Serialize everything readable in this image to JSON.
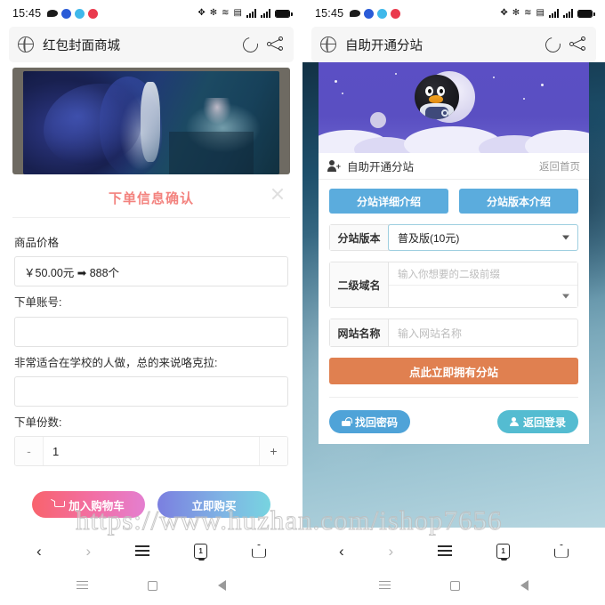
{
  "status_bar": {
    "time": "15:45",
    "app_icons": [
      "message-icon",
      "qq-icon",
      "wechat-icon",
      "weibo-icon"
    ],
    "right_icons": [
      "nfc-icon",
      "bluetooth-icon",
      "wifi-icon",
      "vpn-icon",
      "signal-1-icon",
      "signal-2-icon",
      "battery-icon"
    ]
  },
  "left_phone": {
    "browser": {
      "title": "红包封面商城",
      "reload_label": "刷新",
      "share_label": "分享"
    },
    "hero_alt": "红包封面预览图",
    "dialog": {
      "title": "下单信息确认",
      "close_label": "×",
      "fields": [
        {
          "label": "商品价格",
          "value": "￥50.00元 ➡ 888个",
          "placeholder": "",
          "readonly": true
        },
        {
          "label": "下单账号:",
          "value": "",
          "placeholder": "",
          "readonly": false
        },
        {
          "label": "非常适合在学校的人做，总的来说咯克拉:",
          "value": "",
          "placeholder": "",
          "readonly": false
        }
      ],
      "quantity": {
        "label": "下单份数:",
        "minus": "-",
        "value": "1",
        "plus": "+"
      },
      "buttons": {
        "add_cart": "加入购物车",
        "buy_now": "立即购买"
      }
    }
  },
  "right_phone": {
    "browser": {
      "title": "自助开通分站",
      "reload_label": "刷新",
      "share_label": "分享"
    },
    "banner": {
      "mascot": "qq-penguin-icon",
      "title": "自助开通分站",
      "home_link": "返回首页"
    },
    "top_buttons": [
      "分站详细介绍",
      "分站版本介绍"
    ],
    "form": {
      "version": {
        "label": "分站版本",
        "value": "普及版(10元)"
      },
      "domain": {
        "label": "二级域名",
        "prefix_placeholder": "输入你想要的二级前缀",
        "suffix_value": ""
      },
      "site_name": {
        "label": "网站名称",
        "placeholder": "输入网站名称"
      },
      "submit": "点此立即拥有分站"
    },
    "footer_buttons": [
      {
        "label": "找回密码",
        "icon": "lock-icon"
      },
      {
        "label": "返回登录",
        "icon": "user-icon"
      }
    ]
  },
  "browser_nav": {
    "back": "‹",
    "forward": "›",
    "menu": "menu-icon",
    "tabs": "1",
    "home": "home-icon"
  },
  "system_nav": {
    "recents": "recents-icon",
    "home": "home-square-icon",
    "back": "back-triangle-icon"
  },
  "watermark": "https://www.huzhan.com/ishop7656",
  "colors": {
    "accent_pink": "#f3837f",
    "cart_gradient_start": "#f8636d",
    "buy_gradient_start": "#7b7fe0",
    "panel_blue": "#5bacdd",
    "submit_orange": "#e08050",
    "pill_blue": "#4fa3d8",
    "pill_teal": "#54bcd1",
    "banner_purple": "#5b4fc4"
  }
}
